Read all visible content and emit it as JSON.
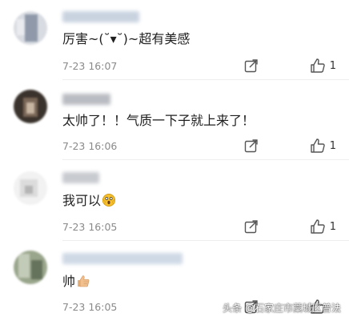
{
  "comments": [
    {
      "text": "厉害~(˘▾˘)~超有美感",
      "time": "7-23 16:07",
      "likes": "1",
      "author_colors": [
        "#cfd2d8",
        "#9aa4b5",
        "#e3e6ec"
      ],
      "name_color": "#c9d3e0"
    },
    {
      "text": "太帅了！！气质一下子就上来了！",
      "time": "7-23 16:06",
      "likes": "1",
      "author_colors": [
        "#2a2522",
        "#6b5a4d",
        "#c9b9a8"
      ],
      "name_color": "#b9bcc2"
    },
    {
      "text": "我可以",
      "emoji": "scream-emoji",
      "time": "7-23 16:05",
      "likes": "1",
      "author_colors": [
        "#f0f0f0",
        "#d9d9d9",
        "#bfbfbf"
      ],
      "name_color": "#c8cbd0"
    },
    {
      "text": "帅",
      "emoji": "thumbs-up-emoji",
      "time": "7-23 16:05",
      "likes": "",
      "author_colors": [
        "#8c9a7d",
        "#b8c2ae",
        "#5e6b55"
      ],
      "name_color": "#cfd9e6"
    }
  ],
  "watermark": "头条 @石家庄市藁城区普法",
  "icons": {
    "share": "share-icon",
    "like": "thumbs-up-icon"
  },
  "colors": {
    "time_text": "#8a8a8a",
    "comment_text": "#1f1f1f",
    "divider": "#eeeeee"
  }
}
